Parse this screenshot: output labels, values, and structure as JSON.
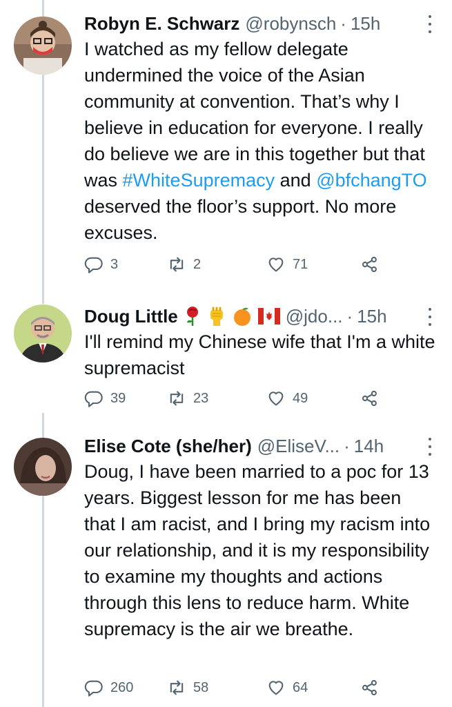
{
  "tweets": [
    {
      "name": "Robyn E. Schwarz",
      "handle": "@robynsch",
      "separator": "·",
      "time": "15h",
      "text_parts": [
        "I watched as my fellow delegate undermined the voice of the Asian community at convention. That’s why I believe in education for everyone. I really do believe we are in this together but that was ",
        "#WhiteSupremacy",
        " and ",
        "@bfchangTO",
        " deserved the floor’s support. No more excuses."
      ],
      "replies": "3",
      "retweets": "2",
      "likes": "71"
    },
    {
      "name": "Doug Little",
      "emoji": [
        "rose-emoji",
        "raised-fist-emoji",
        "orange-emoji",
        "canada-flag-emoji"
      ],
      "handle": "@jdo...",
      "separator": "·",
      "time": "15h",
      "text": "I'll remind my Chinese wife that I'm a white supremacist",
      "replies": "39",
      "retweets": "23",
      "likes": "49"
    },
    {
      "name": "Elise Cote (she/her)",
      "handle": "@EliseV...",
      "separator": "·",
      "time": "14h",
      "text": "Doug, I have been married to a poc for 13 years. Biggest lesson for me has been that I am racist, and I bring my racism into our relationship, and it is my responsibility to examine my thoughts and actions through this lens to reduce harm. White supremacy is the air we breathe.",
      "replies": "260",
      "retweets": "58",
      "likes": "64"
    }
  ],
  "colors": {
    "link": "#1d9bf0",
    "muted": "#536471",
    "thread_line": "#cfd9de"
  }
}
